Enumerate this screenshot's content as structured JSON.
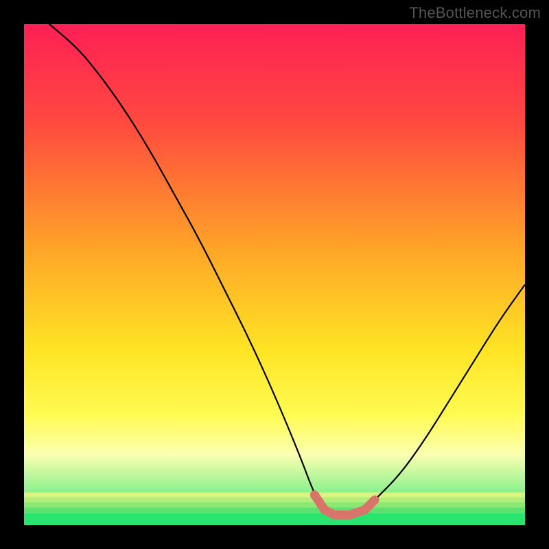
{
  "watermark": "TheBottleneck.com",
  "chart_data": {
    "type": "line",
    "title": "",
    "xlabel": "",
    "ylabel": "",
    "xlim": [
      0,
      100
    ],
    "ylim": [
      0,
      100
    ],
    "series": [
      {
        "name": "bottleneck-curve",
        "x": [
          5,
          10,
          15,
          20,
          25,
          30,
          35,
          40,
          45,
          50,
          55,
          58,
          60,
          62,
          65,
          68,
          70,
          75,
          80,
          85,
          90,
          95,
          100
        ],
        "values": [
          100,
          96,
          90,
          83,
          75,
          66,
          57,
          47,
          37,
          26,
          14,
          6,
          3,
          2,
          2,
          3,
          5,
          10,
          17,
          25,
          33,
          41,
          48
        ]
      }
    ],
    "highlight_range_x": [
      56,
      70
    ],
    "gradient_stops": [
      {
        "offset": 0,
        "color": "#ff1f55"
      },
      {
        "offset": 20,
        "color": "#ff4a3f"
      },
      {
        "offset": 45,
        "color": "#ffa528"
      },
      {
        "offset": 65,
        "color": "#ffe424"
      },
      {
        "offset": 78,
        "color": "#fffb52"
      },
      {
        "offset": 86,
        "color": "#fbffb0"
      },
      {
        "offset": 100,
        "color": "#29e56f"
      }
    ],
    "green_bands": [
      {
        "y": 93.5,
        "h": 1.0,
        "color": "#d7f57f"
      },
      {
        "y": 94.5,
        "h": 1.0,
        "color": "#b4ed78"
      },
      {
        "y": 95.5,
        "h": 1.0,
        "color": "#8ce873"
      },
      {
        "y": 96.5,
        "h": 1.2,
        "color": "#5fe170"
      },
      {
        "y": 97.7,
        "h": 2.3,
        "color": "#29e56f"
      }
    ],
    "colors": {
      "curve": "#000000",
      "highlight": "#d9746b"
    }
  }
}
